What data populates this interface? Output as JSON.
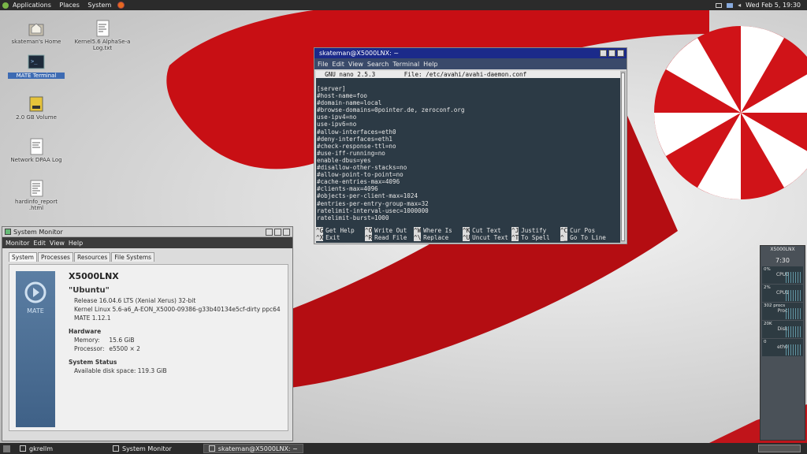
{
  "top_panel": {
    "menus": [
      "Applications",
      "Places",
      "System"
    ],
    "clock": "Wed Feb  5, 19:30"
  },
  "desktop": {
    "icons": [
      {
        "label": "skateman's Home"
      },
      {
        "label": "Kernel5.6 AlphaSe-a Log.txt"
      },
      {
        "label": "MATE Terminal"
      },
      {
        "label": "2.0 GB Volume"
      },
      {
        "label": "Network DPAA Log"
      },
      {
        "label": "hardinfo_report .html"
      }
    ]
  },
  "terminal": {
    "title": "skateman@X5000LNX: ~",
    "menu": [
      "File",
      "Edit",
      "View",
      "Search",
      "Terminal",
      "Help"
    ],
    "nano_header": "  GNU nano 2.5.3        File: /etc/avahi/avahi-daemon.conf",
    "lines": [
      "[server]",
      "#host-name=foo",
      "#domain-name=local",
      "#browse-domains=0pointer.de, zeroconf.org",
      "use-ipv4=no",
      "use-ipv6=no",
      "#allow-interfaces=eth0",
      "#deny-interfaces=eth1",
      "#check-response-ttl=no",
      "#use-iff-running=no",
      "enable-dbus=yes",
      "#disallow-other-stacks=no",
      "#allow-point-to-point=no",
      "#cache-entries-max=4096",
      "#clients-max=4096",
      "#objects-per-client-max=1024",
      "#entries-per-entry-group-max=32",
      "ratelimit-interval-usec=1000000",
      "ratelimit-burst=1000"
    ],
    "keys_row1": [
      [
        "^G",
        "Get Help"
      ],
      [
        "^O",
        "Write Out"
      ],
      [
        "^W",
        "Where Is"
      ],
      [
        "^K",
        "Cut Text"
      ],
      [
        "^J",
        "Justify"
      ],
      [
        "^C",
        "Cur Pos"
      ]
    ],
    "keys_row2": [
      [
        "^X",
        "Exit"
      ],
      [
        "^R",
        "Read File"
      ],
      [
        "^\\",
        "Replace"
      ],
      [
        "^U",
        "Uncut Text"
      ],
      [
        "^T",
        "To Spell"
      ],
      [
        "^_",
        "Go To Line"
      ]
    ]
  },
  "sysmon": {
    "title": "System Monitor",
    "menu": [
      "Monitor",
      "Edit",
      "View",
      "Help"
    ],
    "tabs": [
      "System",
      "Processes",
      "Resources",
      "File Systems"
    ],
    "logo_text": "MATE",
    "hostname": "X5000LNX",
    "os_name": "\"Ubuntu\"",
    "release": "Release 16.04.6 LTS (Xenial Xerus) 32-bit",
    "kernel": "Kernel Linux 5.6-a6_A-EON_X5000-09386-g33b40134e5cf-dirty ppc64",
    "mate": "MATE 1.12.1",
    "hardware_heading": "Hardware",
    "memory_label": "Memory:",
    "memory_value": "15.6 GiB",
    "processor_label": "Processor:",
    "processor_value": "e5500 × 2",
    "status_heading": "System Status",
    "disk_label": "Available disk space:",
    "disk_value": "119.3 GiB"
  },
  "gkrellm": {
    "host": "X5000LNX",
    "time": "7:30",
    "panels": [
      {
        "pct": "0%",
        "label": "CPU0"
      },
      {
        "pct": "2%",
        "label": "CPU1"
      },
      {
        "pct": "302 procs",
        "label": "Proc"
      },
      {
        "pct": "20K",
        "label": "Disk"
      },
      {
        "pct": "0",
        "label": "eth0"
      }
    ]
  },
  "taskbar": {
    "items": [
      {
        "label": "gkrellm",
        "active": false
      },
      {
        "label": "System Monitor",
        "active": false
      },
      {
        "label": "skateman@X5000LNX: ~",
        "active": true
      }
    ]
  }
}
